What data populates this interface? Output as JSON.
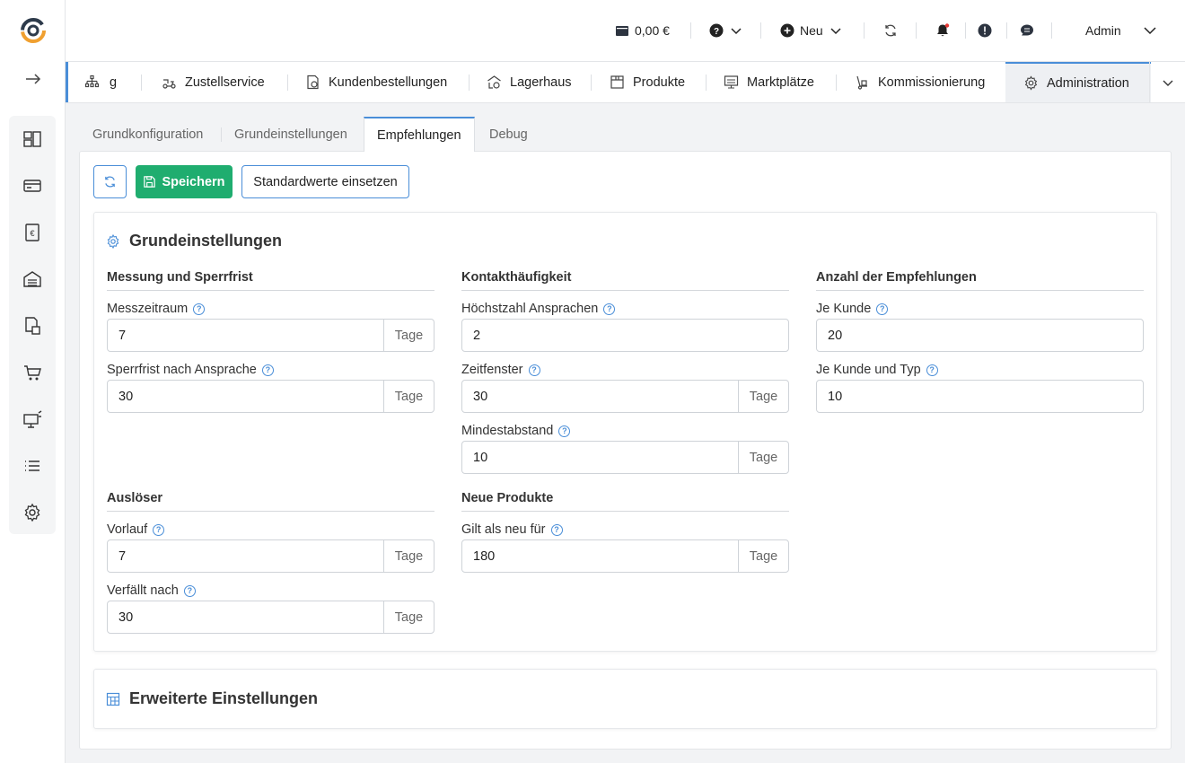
{
  "header": {
    "balance": "0,00 €",
    "new_label": "Neu",
    "user": "Admin"
  },
  "module_tabs": {
    "truncated_label": "g",
    "items": [
      {
        "label": "Zustellservice",
        "icon": "delivery-icon"
      },
      {
        "label": "Kundenbestellungen",
        "icon": "customer-orders-icon"
      },
      {
        "label": "Lagerhaus",
        "icon": "warehouse-icon"
      },
      {
        "label": "Produkte",
        "icon": "products-icon"
      },
      {
        "label": "Marktplätze",
        "icon": "marketplaces-icon"
      },
      {
        "label": "Kommissionierung",
        "icon": "picking-icon"
      },
      {
        "label": "Administration",
        "icon": "gear-icon",
        "active": true
      }
    ]
  },
  "sub_tabs": [
    {
      "label": "Grundkonfiguration"
    },
    {
      "label": "Grundeinstellungen"
    },
    {
      "label": "Empfehlungen",
      "active": true
    },
    {
      "label": "Debug"
    }
  ],
  "toolbar": {
    "save_label": "Speichern",
    "defaults_label": "Standardwerte einsetzen"
  },
  "card_basic": {
    "title": "Grundeinstellungen",
    "sections": {
      "messung": {
        "title": "Messung und Sperrfrist",
        "fields": {
          "messzeitraum": {
            "label": "Messzeitraum",
            "value": "7",
            "unit": "Tage"
          },
          "sperrfrist": {
            "label": "Sperrfrist nach Ansprache",
            "value": "30",
            "unit": "Tage"
          }
        }
      },
      "kontakt": {
        "title": "Kontakthäufigkeit",
        "fields": {
          "hoechstzahl": {
            "label": "Höchstzahl Ansprachen",
            "value": "2"
          },
          "zeitfenster": {
            "label": "Zeitfenster",
            "value": "30",
            "unit": "Tage"
          },
          "mindestabstand": {
            "label": "Mindestabstand",
            "value": "10",
            "unit": "Tage"
          }
        }
      },
      "anzahl": {
        "title": "Anzahl der Empfehlungen",
        "fields": {
          "je_kunde": {
            "label": "Je Kunde",
            "value": "20"
          },
          "je_kunde_typ": {
            "label": "Je Kunde und Typ",
            "value": "10"
          }
        }
      },
      "ausloeser": {
        "title": "Auslöser",
        "fields": {
          "vorlauf": {
            "label": "Vorlauf",
            "value": "7",
            "unit": "Tage"
          },
          "verfaellt": {
            "label": "Verfällt nach",
            "value": "30",
            "unit": "Tage"
          }
        }
      },
      "neue_produkte": {
        "title": "Neue Produkte",
        "fields": {
          "gilt_neu": {
            "label": "Gilt als neu für",
            "value": "180",
            "unit": "Tage"
          }
        }
      }
    }
  },
  "card_advanced": {
    "title": "Erweiterte Einstellungen"
  },
  "colors": {
    "accent": "#4a8ed8",
    "save": "#1fad6f",
    "notification_dot": "#e53935"
  }
}
